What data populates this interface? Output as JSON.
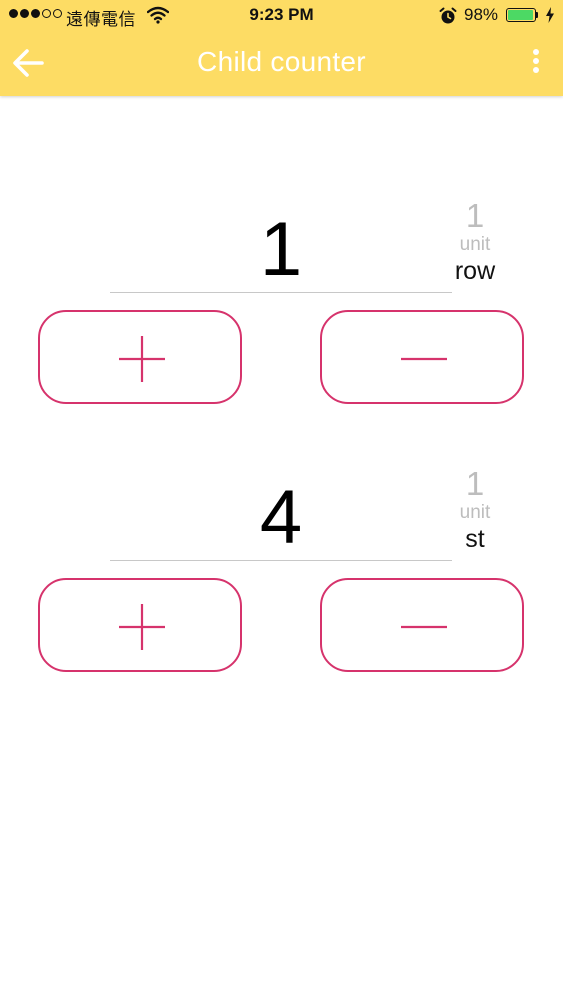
{
  "status_bar": {
    "carrier": "遠傳電信",
    "time": "9:23 PM",
    "battery_percent": "98%",
    "battery_level": 0.98
  },
  "header": {
    "title": "Child counter"
  },
  "counters": [
    {
      "value": "1",
      "unit_count": "1",
      "unit_label": "unit",
      "unit_name": "row"
    },
    {
      "value": "4",
      "unit_count": "1",
      "unit_label": "unit",
      "unit_name": "st"
    }
  ],
  "colors": {
    "header_bg": "#fddc64",
    "button_accent": "#d6336c",
    "battery": "#4cd964"
  },
  "icons": {
    "back": "arrow-left-icon",
    "menu": "more-vertical-icon",
    "increment": "plus-icon",
    "decrement": "minus-icon"
  }
}
